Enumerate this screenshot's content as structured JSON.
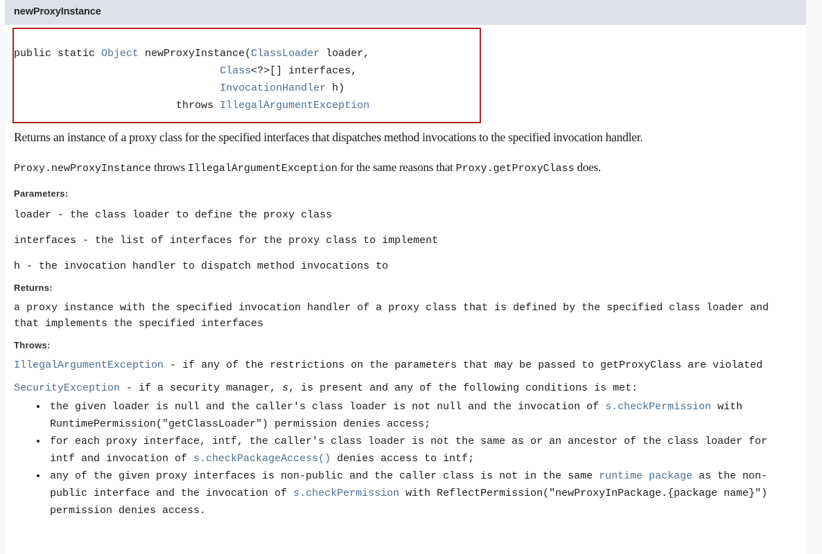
{
  "header": {
    "title": "newProxyInstance",
    "background_color": "#dee2e8"
  },
  "signature": {
    "border_color": "#b41f24",
    "link_color": "#4c6e91",
    "line1_pre": "public static ",
    "line1_type": "Object",
    "line1_mid": " newProxyInstance(",
    "line1_param_type": "ClassLoader",
    "line1_param_name": " loader,",
    "line2_indent": "                                 ",
    "line2_type": "Class",
    "line2_rest": "<?>[] interfaces,",
    "line3_indent": "                                 ",
    "line3_type": "InvocationHandler",
    "line3_rest": " h)",
    "line4_indent": "                          ",
    "line4_throws": "throws ",
    "line4_type": "IllegalArgumentException"
  },
  "description": {
    "paragraph1": "Returns an instance of a proxy class for the specified interfaces that dispatches method invocations to the specified invocation handler.",
    "p2_code1": "Proxy.newProxyInstance",
    "p2_text1": " throws ",
    "p2_code2": "IllegalArgumentException",
    "p2_text2": " for the same reasons that ",
    "p2_code3": "Proxy.getProxyClass",
    "p2_text3": " does."
  },
  "parameters": {
    "label": "Parameters:",
    "items": [
      "loader - the class loader to define the proxy class",
      "interfaces - the list of interfaces for the proxy class to implement",
      "h - the invocation handler to dispatch method invocations to"
    ]
  },
  "returns": {
    "label": "Returns:",
    "text": "a proxy instance with the specified invocation handler of a proxy class that is defined by the specified class loader and that implements the specified interfaces"
  },
  "throws": {
    "label": "Throws:",
    "entry1": {
      "exception": "IllegalArgumentException",
      "dash": " - ",
      "text": "if any of the restrictions on the parameters that may be passed to getProxyClass are violated"
    },
    "entry2": {
      "exception": "SecurityException",
      "dash": " - ",
      "text_before": "if a security manager, ",
      "variable": "s",
      "text_after": ", is present and any of the following conditions is met:"
    },
    "conditions": [
      {
        "part1": "the given loader is null and the caller's class loader is not null and the invocation of ",
        "link1": "s.checkPermission",
        "part2": " with RuntimePermission(\"getClassLoader\") permission denies access;"
      },
      {
        "part1": "for each proxy interface, intf, the caller's class loader is not the same as or an ancestor of the class loader for intf and invocation of ",
        "link1": "s.checkPackageAccess()",
        "part2": " denies access to intf;"
      },
      {
        "part1": "any of the given proxy interfaces is non-public and the caller class is not in the same ",
        "link1": "runtime package",
        "part2": " as the non-public interface and the invocation of ",
        "link2": "s.checkPermission",
        "part3": " with ReflectPermission(\"newProxyInPackage.{package name}\") permission denies access."
      }
    ]
  }
}
